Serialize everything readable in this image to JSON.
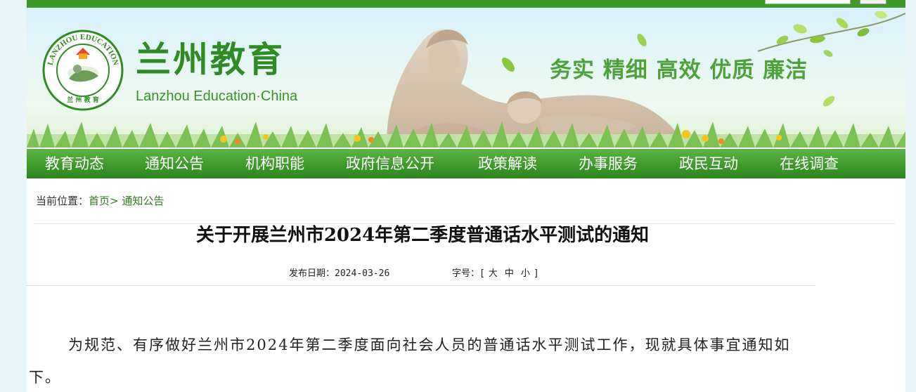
{
  "header": {
    "site_title": "兰州教育",
    "site_subtitle": "Lanzhou Education·China",
    "logo_text_top": "LANZHOU EDUCATION",
    "logo_text_bottom": "兰 州 教 育",
    "slogan": "务实 精细 高效 优质 廉洁"
  },
  "nav": {
    "items": [
      {
        "label": "教育动态"
      },
      {
        "label": "通知公告"
      },
      {
        "label": "机构职能"
      },
      {
        "label": "政府信息公开"
      },
      {
        "label": "政策解读"
      },
      {
        "label": "办事服务"
      },
      {
        "label": "政民互动"
      },
      {
        "label": "在线调查"
      }
    ]
  },
  "breadcrumb": {
    "prefix": "当前位置：",
    "home": "首页",
    "separator": ">",
    "current": "通知公告"
  },
  "article": {
    "title": "关于开展兰州市2024年第二季度普通话水平测试的通知",
    "date_label": "发布日期：",
    "date": "2024-03-26",
    "font_label": "字号：[",
    "font_large": "大",
    "font_medium": "中",
    "font_small": "小",
    "font_close": "]",
    "paragraph": "为规范、有序做好兰州市2024年第二季度面向社会人员的普通话水平测试工作，现就具体事宜通知如下。"
  },
  "colors": {
    "brand_green": "#3f9a2c",
    "title_green": "#2f8b24",
    "slogan_green": "#4da23a",
    "page_bg": "#e9f6f7"
  },
  "icons": {
    "logo": "lanzhou-education-emblem",
    "statue": "yellow-river-mother-statue"
  }
}
